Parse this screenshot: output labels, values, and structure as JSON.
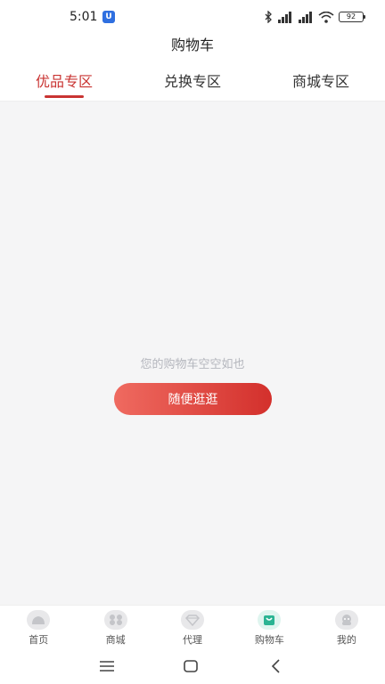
{
  "status_bar": {
    "time": "5:01",
    "battery": "92"
  },
  "header": {
    "title": "购物车"
  },
  "tabs": [
    {
      "label": "优品专区",
      "active": true
    },
    {
      "label": "兑换专区",
      "active": false
    },
    {
      "label": "商城专区",
      "active": false
    }
  ],
  "empty_state": {
    "message": "您的购物车空空如也",
    "button_label": "随便逛逛"
  },
  "bottom_nav": [
    {
      "label": "首页",
      "icon": "home-icon"
    },
    {
      "label": "商城",
      "icon": "mall-icon"
    },
    {
      "label": "代理",
      "icon": "diamond-icon"
    },
    {
      "label": "购物车",
      "icon": "cart-icon",
      "active": true
    },
    {
      "label": "我的",
      "icon": "profile-icon"
    }
  ],
  "colors": {
    "accent": "#c93432",
    "button_start": "#ef6a60",
    "button_end": "#d3302c",
    "nav_active": "#2bb493"
  }
}
